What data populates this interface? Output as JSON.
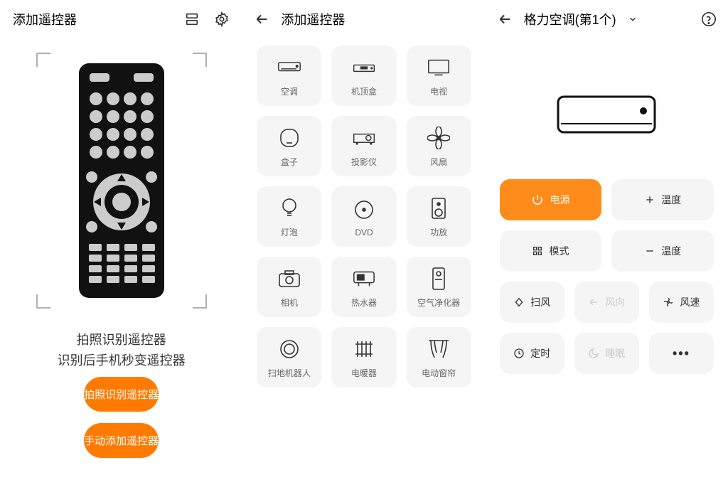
{
  "screen1": {
    "title": "添加遥控器",
    "promo_line1": "拍照识别遥控器",
    "promo_line2": "识别后手机秒变遥控器",
    "btn_photo": "拍照识别遥控器",
    "btn_manual": "手动添加遥控器"
  },
  "screen2": {
    "title": "添加遥控器",
    "devices": [
      {
        "label": "空调"
      },
      {
        "label": "机顶盒"
      },
      {
        "label": "电视"
      },
      {
        "label": "盒子"
      },
      {
        "label": "投影仪"
      },
      {
        "label": "风扇"
      },
      {
        "label": "灯泡"
      },
      {
        "label": "DVD"
      },
      {
        "label": "功放"
      },
      {
        "label": "相机"
      },
      {
        "label": "热水器"
      },
      {
        "label": "空气净化器"
      },
      {
        "label": "扫地机器人"
      },
      {
        "label": "电暖器"
      },
      {
        "label": "电动窗帘"
      }
    ]
  },
  "screen3": {
    "title": "格力空调(第1个)",
    "controls": {
      "power": "电源",
      "temp_up": "温度",
      "mode": "模式",
      "temp_down": "温度",
      "swing": "扫风",
      "direction": "风向",
      "speed": "风速",
      "timer": "定时",
      "sleep": "睡眠",
      "more": "•••"
    }
  }
}
